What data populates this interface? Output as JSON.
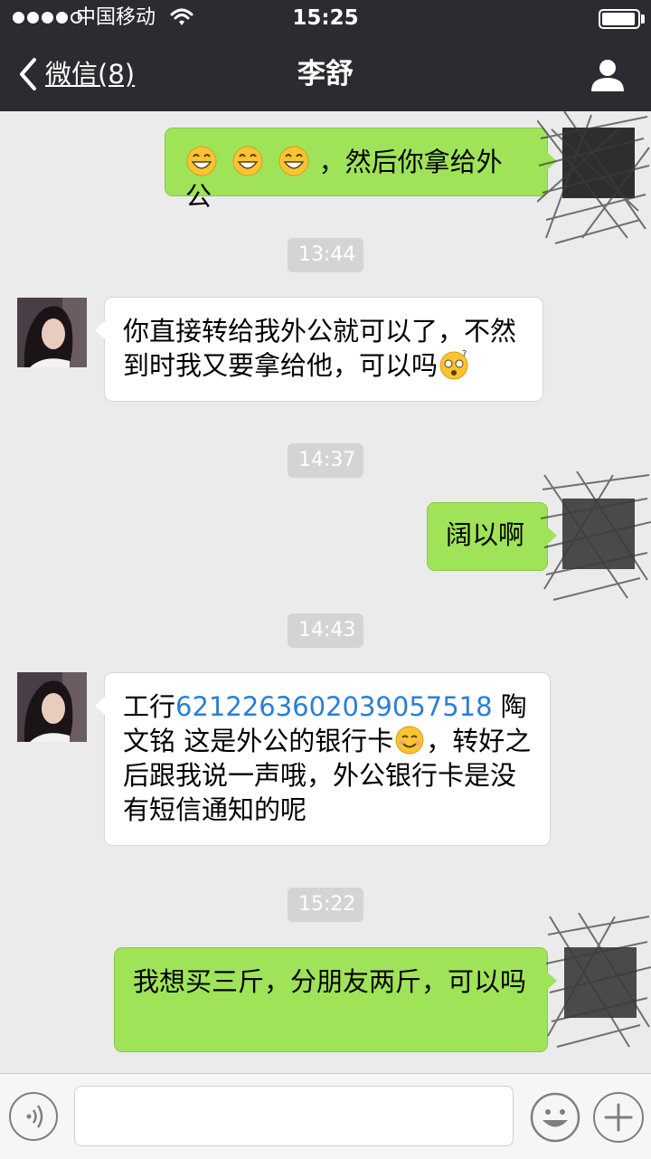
{
  "status_bar": {
    "carrier": "中国移动",
    "time": "15:25",
    "signal_bars_filled": 4,
    "signal_bars_total": 5,
    "battery_level": 0.95
  },
  "nav": {
    "back_label": "微信(8)",
    "title": "李舒",
    "back_icon": "chevron-left-icon",
    "profile_icon": "person-icon"
  },
  "messages": [
    {
      "type": "outgoing",
      "text": "，然后你拿给外公",
      "emoji_prefix": [
        "grin-emoji",
        "grin-emoji",
        "grin-emoji"
      ]
    },
    {
      "type": "timestamp",
      "text": "13:44"
    },
    {
      "type": "incoming",
      "text": "你直接转给我外公就可以了，不然到时我又要拿给他，可以吗",
      "emoji_suffix": "dizzy-face-emoji"
    },
    {
      "type": "timestamp",
      "text": "14:37"
    },
    {
      "type": "outgoing",
      "text": "阔以啊"
    },
    {
      "type": "timestamp",
      "text": "14:43"
    },
    {
      "type": "incoming",
      "text_before_link": "工行",
      "link": "6212263602039057518",
      "text_after_link": " 陶文铭 这是外公的银行卡",
      "emoji_mid": "smile-emoji",
      "text_after_emoji": "，转好之后跟我说一声哦，外公银行卡是没有短信通知的呢"
    },
    {
      "type": "timestamp",
      "text": "15:22"
    },
    {
      "type": "outgoing",
      "text": "我想买三斤，分朋友两斤，可以吗"
    }
  ],
  "input_bar": {
    "placeholder": "",
    "voice_icon": "voice-icon",
    "emoji_icon": "emoji-icon",
    "plus_icon": "plus-icon"
  },
  "colors": {
    "bar_bg": "#2b2b30",
    "chat_bg": "#ebebeb",
    "outgoing_bubble": "#9fe458",
    "incoming_bubble": "#ffffff",
    "link": "#2a7fd4",
    "timestamp_bg": "#d4d4d4"
  }
}
